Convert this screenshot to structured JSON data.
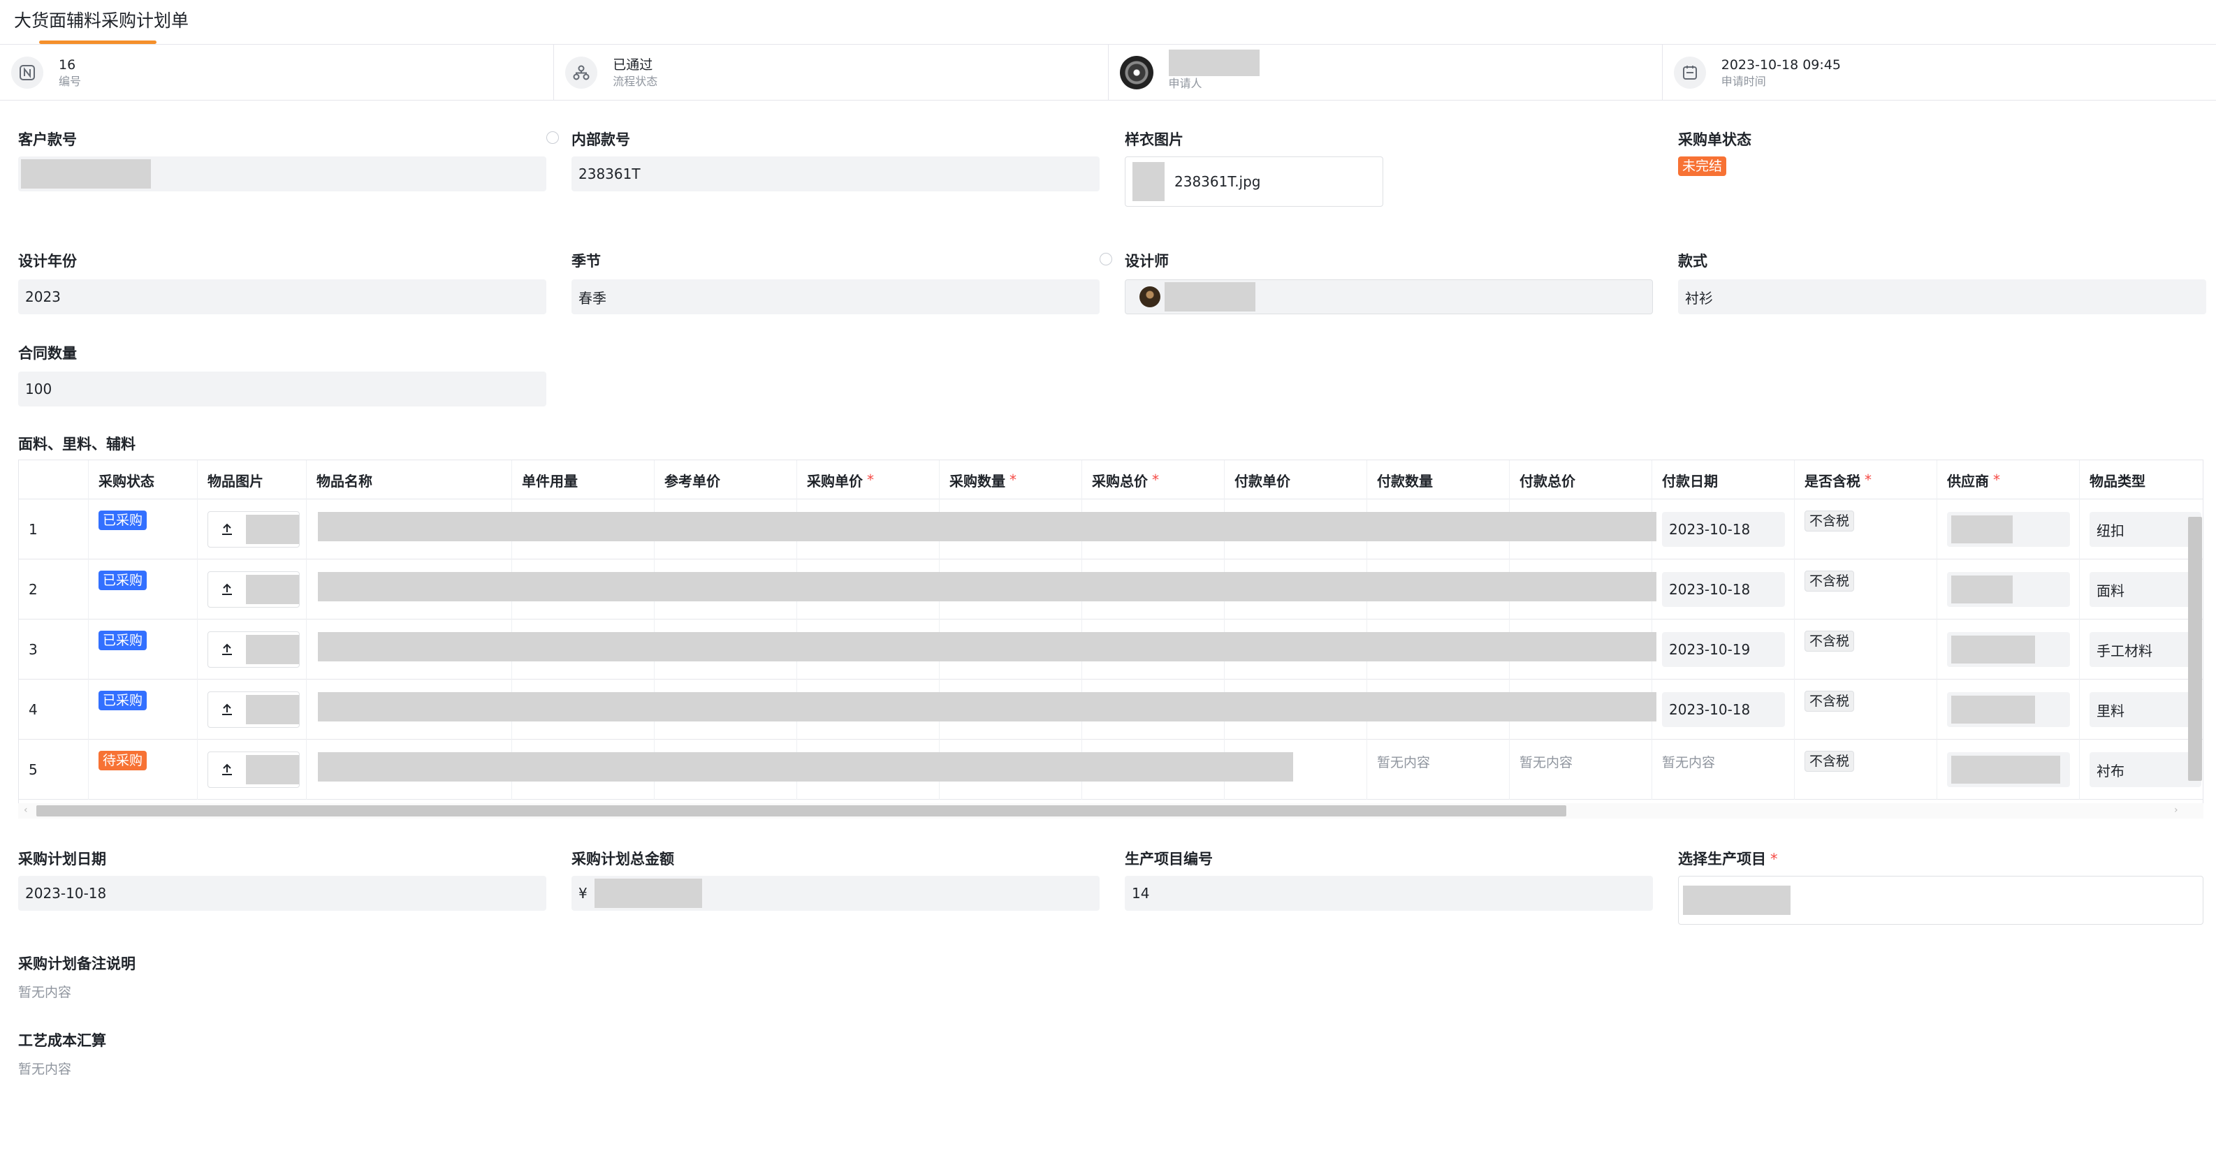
{
  "page": {
    "title": "大货面辅料采购计划单"
  },
  "info_bar": [
    {
      "value": "16",
      "label": "编号",
      "icon": "number-icon"
    },
    {
      "value": "已通过",
      "label": "流程状态",
      "icon": "workflow-icon"
    },
    {
      "value": "",
      "label": "申请人",
      "icon": "avatar"
    },
    {
      "value": "2023-10-18 09:45",
      "label": "申请时间",
      "icon": "calendar-icon"
    }
  ],
  "form": {
    "customer_no": {
      "label": "客户款号",
      "value": ""
    },
    "internal_no": {
      "label": "内部款号",
      "value": "238361T"
    },
    "sample_image": {
      "label": "样衣图片",
      "filename": "238361T.jpg"
    },
    "po_status": {
      "label": "采购单状态",
      "value": "未完结"
    },
    "design_year": {
      "label": "设计年份",
      "value": "2023"
    },
    "season": {
      "label": "季节",
      "value": "春季"
    },
    "designer": {
      "label": "设计师",
      "value": ""
    },
    "style": {
      "label": "款式",
      "value": "衬衫"
    },
    "contract_qty": {
      "label": "合同数量",
      "value": "100"
    }
  },
  "table": {
    "section_title": "面料、里料、辅料",
    "columns": [
      {
        "label": "",
        "required": false
      },
      {
        "label": "采购状态",
        "required": false
      },
      {
        "label": "物品图片",
        "required": false
      },
      {
        "label": "物品名称",
        "required": false
      },
      {
        "label": "单件用量",
        "required": false
      },
      {
        "label": "参考单价",
        "required": false
      },
      {
        "label": "采购单价",
        "required": true
      },
      {
        "label": "采购数量",
        "required": true
      },
      {
        "label": "采购总价",
        "required": true
      },
      {
        "label": "付款单价",
        "required": false
      },
      {
        "label": "付款数量",
        "required": false
      },
      {
        "label": "付款总价",
        "required": false
      },
      {
        "label": "付款日期",
        "required": false
      },
      {
        "label": "是否含税",
        "required": true
      },
      {
        "label": "供应商",
        "required": true
      },
      {
        "label": "物品类型",
        "required": false
      }
    ],
    "rows": [
      {
        "no": "1",
        "status": "已采购",
        "status_color": "#3370ff",
        "pay_date": "2023-10-18",
        "tax": "不含税",
        "item_type": "纽扣",
        "pay_qty": "",
        "pay_total": "",
        "pay_empty": false
      },
      {
        "no": "2",
        "status": "已采购",
        "status_color": "#3370ff",
        "pay_date": "2023-10-18",
        "tax": "不含税",
        "item_type": "面料",
        "pay_qty": "",
        "pay_total": "",
        "pay_empty": false
      },
      {
        "no": "3",
        "status": "已采购",
        "status_color": "#3370ff",
        "pay_date": "2023-10-19",
        "tax": "不含税",
        "item_type": "手工材料",
        "pay_qty": "",
        "pay_total": "",
        "pay_empty": false
      },
      {
        "no": "4",
        "status": "已采购",
        "status_color": "#3370ff",
        "pay_date": "2023-10-18",
        "tax": "不含税",
        "item_type": "里料",
        "pay_qty": "",
        "pay_total": "",
        "pay_empty": false
      },
      {
        "no": "5",
        "status": "待采购",
        "status_color": "#f77234",
        "pay_date": "暂无内容",
        "tax": "不含税",
        "item_type": "衬布",
        "pay_qty": "暂无内容",
        "pay_total": "暂无内容",
        "pay_empty": true
      }
    ]
  },
  "bottom": {
    "plan_date": {
      "label": "采购计划日期",
      "value": "2023-10-18"
    },
    "plan_total": {
      "label": "采购计划总金额",
      "prefix": "¥"
    },
    "project_no": {
      "label": "生产项目编号",
      "value": "14"
    },
    "select_project": {
      "label": "选择生产项目"
    },
    "remark": {
      "label": "采购计划备注说明",
      "value": "暂无内容"
    },
    "craft_cost": {
      "label": "工艺成本汇算",
      "value": "暂无内容"
    }
  },
  "colors": {
    "accent": "#f5902b",
    "blue_tag": "#3370ff",
    "orange_tag": "#f77234",
    "required": "#f54a45"
  }
}
